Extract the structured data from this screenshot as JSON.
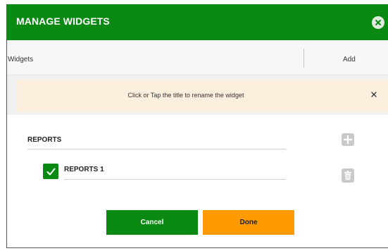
{
  "modal": {
    "title": "MANAGE WIDGETS",
    "close_icon": "close-circle-icon"
  },
  "columns": {
    "widgets": "Widgets",
    "add": "Add"
  },
  "banner": {
    "text": "Click or Tap the title to rename the widget",
    "dismiss_icon": "close-icon"
  },
  "section": {
    "label": "REPORTS",
    "add_icon": "plus-icon",
    "items": [
      {
        "label": "REPORTS 1",
        "checked": true,
        "delete_icon": "trash-icon"
      }
    ]
  },
  "actions": {
    "cancel_label": "Cancel",
    "done_label": "Done"
  },
  "colors": {
    "header": "#0b8a13",
    "banner": "#fcefdd",
    "done": "#ff9a00",
    "icon_gray": "#c9c9c9"
  }
}
